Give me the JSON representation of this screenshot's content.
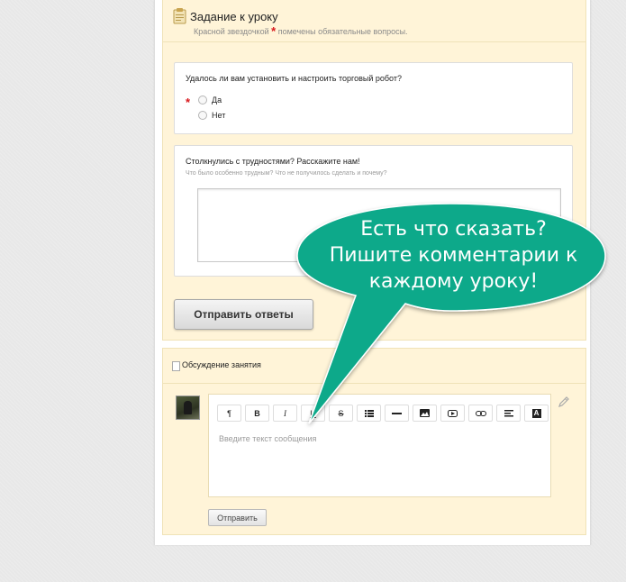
{
  "task": {
    "title": "Задание к уроку",
    "subtitle_before": "Красной звездочкой",
    "subtitle_star": "*",
    "subtitle_after": "помечены обязательные вопросы.",
    "q1": {
      "title": "Удалось ли вам установить и настроить торговый робот?",
      "required_mark": "*",
      "options": [
        "Да",
        "Нет"
      ]
    },
    "q2": {
      "title": "Столкнулись с трудностями? Расскажите нам!",
      "hint": "Что было особенно трудным? Что не получилось сделать и почему?"
    },
    "submit_label": "Отправить ответы"
  },
  "discussion": {
    "title": "Обсуждение занятия",
    "toolbar": [
      "¶",
      "B",
      "I",
      "U",
      "S",
      "list",
      "—",
      "image",
      "video",
      "link",
      "align",
      "A"
    ],
    "placeholder": "Введите текст сообщения",
    "send_label": "Отправить"
  },
  "callout": {
    "lines": [
      "Есть что сказать?",
      "Пишите комментарии к",
      "каждому уроку!"
    ],
    "color": "#0aa98a"
  }
}
